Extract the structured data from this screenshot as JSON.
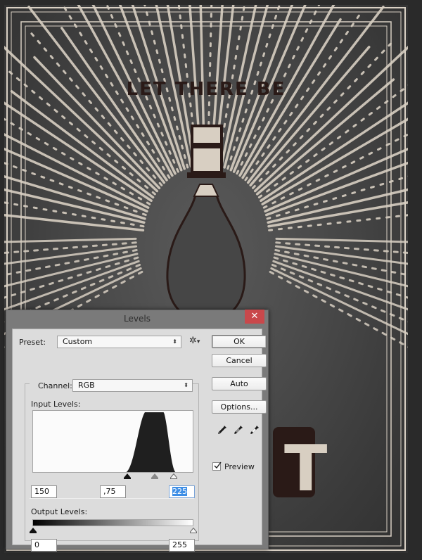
{
  "poster": {
    "headline": "LET THERE BE",
    "big_letter_visible": "T",
    "colors": {
      "background": "#4a4a4a",
      "ray": "#d8cfc2",
      "ink": "#2a1a17",
      "frame": "#d9d0c4"
    }
  },
  "dialog": {
    "title": "Levels",
    "close_icon": "close-icon",
    "close_color": "#c9484b",
    "preset": {
      "label": "Preset:",
      "value": "Custom",
      "menu_icon": "gear-icon"
    },
    "channel": {
      "label": "Channel:",
      "value": "RGB"
    },
    "input_levels": {
      "label": "Input Levels:",
      "black": "150",
      "mid": ",75",
      "white": "225",
      "white_selected": true
    },
    "output_levels": {
      "label": "Output Levels:",
      "black": "0",
      "white": "255"
    },
    "buttons": {
      "ok": "OK",
      "cancel": "Cancel",
      "auto": "Auto",
      "options": "Options..."
    },
    "eyedroppers": [
      "black-point-eyedropper-icon",
      "gray-point-eyedropper-icon",
      "white-point-eyedropper-icon"
    ],
    "preview": {
      "label": "Preview",
      "checked": true
    },
    "histogram": {
      "description": "bell-shaped distribution peaking around levels 180-205",
      "peak_range": [
        180,
        205
      ],
      "range": [
        140,
        230
      ]
    }
  }
}
